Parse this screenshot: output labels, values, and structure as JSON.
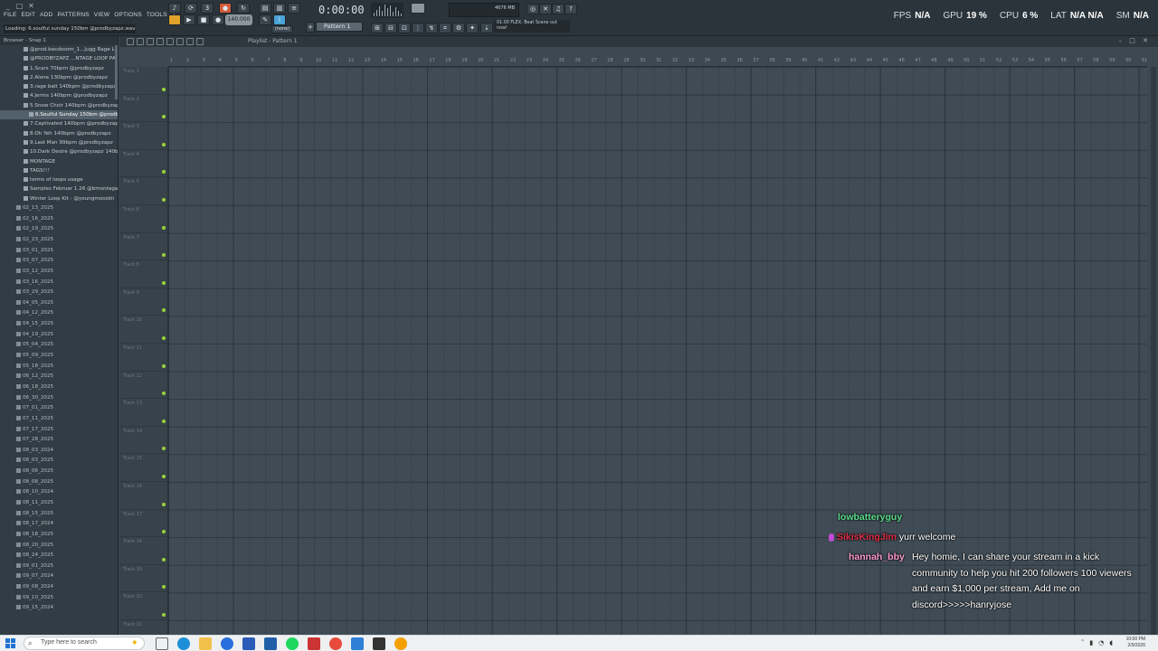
{
  "menu": [
    "FILE",
    "EDIT",
    "ADD",
    "PATTERNS",
    "VIEW",
    "OPTIONS",
    "TOOLS",
    "?"
  ],
  "hint": "Loading: 6.soulful sunday 150bm @prodbyzapz.wav",
  "transport": {
    "time": "0:00:00",
    "tempo": "140.000",
    "pattern": "Pattern 1",
    "snap": "(none)"
  },
  "cpu_box": "4676 MB",
  "notice": "01:00 FLEX: Beat Scene out now!",
  "stats": [
    {
      "label": "FPS",
      "value": "N/A"
    },
    {
      "label": "GPU",
      "value": "19 %"
    },
    {
      "label": "CPU",
      "value": "6 %"
    },
    {
      "label": "LAT",
      "value": "N/A  N/A"
    },
    {
      "label": "SM",
      "value": "N/A"
    }
  ],
  "browser": {
    "title": "Browser - Snap 1",
    "items": [
      "@prod.bassboom_1...Jugg Rage Loops",
      "@PRODBYZAPZ ...NTAGE LOOP PACK",
      "1.Scars 70bpm @prodbyzapz",
      "2.Alone 130bpm @prodbyzapz",
      "3.rage bait 140bpm @prodbyzapz",
      "4.Jerms 140bpm @prodbyzapz",
      "5.Snow Choir 140bpm @prodbyzapz",
      "6.Soulful Sunday 150bm @prodbyzapz",
      "7.Captivated 140bpm @prodbyzapz",
      "8.Oh Yeh 140bpm @prodbyzapz",
      "9.Last Man 99bpm @prodbyzapz",
      "10.Dark Desire @prodbyzapz 140bpm",
      "MONTAGE",
      "TAGS!!!",
      "terms of loops usage",
      "Samples Februar 1.26 @bmontagain",
      "Winter Loop Kit - @youngmooskii"
    ],
    "selected_index": 7,
    "dates": [
      "02_13_2025",
      "02_16_2025",
      "02_19_2025",
      "02_23_2025",
      "03_01_2025",
      "03_07_2025",
      "03_12_2025",
      "03_16_2025",
      "03_29_2025",
      "04_05_2025",
      "04_12_2025",
      "04_15_2025",
      "04_19_2025",
      "05_04_2025",
      "05_09_2025",
      "05_18_2025",
      "06_12_2025",
      "06_18_2025",
      "06_30_2025",
      "07_01_2025",
      "07_11_2025",
      "07_17_2025",
      "07_28_2025",
      "08_03_2024",
      "08_03_2025",
      "08_06_2025",
      "08_08_2025",
      "08_10_2024",
      "08_11_2025",
      "08_15_2025",
      "08_17_2024",
      "08_18_2025",
      "08_20_2025",
      "08_24_2025",
      "09_01_2025",
      "09_07_2024",
      "09_08_2024",
      "09_10_2025",
      "09_15_2024"
    ]
  },
  "playlist": {
    "title": "Playlist - Pattern 1",
    "bars": [
      1,
      2,
      3,
      4,
      5,
      6,
      7,
      8,
      9,
      10,
      11,
      12,
      13,
      14,
      15,
      16,
      17,
      18,
      19,
      20,
      21,
      22,
      23,
      24,
      25,
      26,
      27,
      28,
      29,
      30,
      31,
      32,
      33,
      34,
      35,
      36,
      37,
      38,
      39,
      40,
      41,
      42,
      43,
      44,
      45,
      46,
      47,
      48,
      49,
      50,
      51,
      52,
      53,
      54,
      55,
      56,
      57,
      58,
      59,
      60,
      61
    ],
    "tracks": [
      "Track 1",
      "Track 2",
      "Track 3",
      "Track 4",
      "Track 5",
      "Track 6",
      "Track 7",
      "Track 8",
      "Track 9",
      "Track 10",
      "Track 11",
      "Track 12",
      "Track 13",
      "Track 14",
      "Track 15",
      "Track 16",
      "Track 17",
      "Track 18",
      "Track 19",
      "Track 20",
      "Track 21"
    ]
  },
  "chat": {
    "m1": {
      "user": "lowbatteryguy",
      "text": ""
    },
    "m2": {
      "user": "SikisKingJim",
      "text": "yurr welcome"
    },
    "m3": {
      "user": "hannah_bby",
      "text": "Hey homie, I can share your stream in a kick community to help you hit 200 followers 100 viewers and earn $1,000 per stream, Add me on discord>>>>>hanryjose"
    }
  },
  "taskbar": {
    "search_placeholder": "Type here to search",
    "time": "10:00 PM",
    "date": "2/9/2026"
  }
}
